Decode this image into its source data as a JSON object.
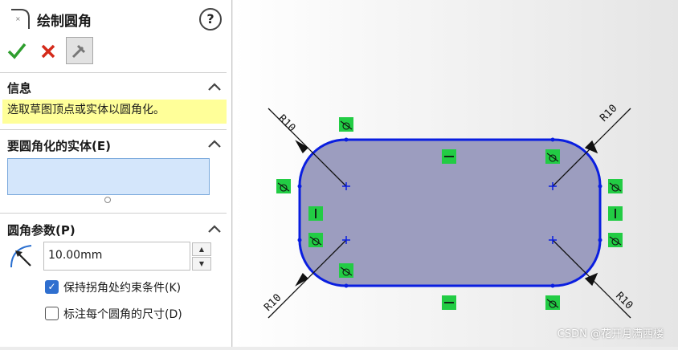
{
  "panel": {
    "title": "绘制圆角",
    "help_label": "?",
    "info": {
      "header": "信息",
      "message": "选取草图顶点或实体以圆角化。"
    },
    "entities": {
      "header": "要圆角化的实体(E)"
    },
    "params": {
      "header": "圆角参数(P)",
      "radius_value": "10.00mm",
      "keep_constraints_label": "保持拐角处约束条件(K)",
      "keep_constraints_checked": true,
      "dimension_each_label": "标注每个圆角的尺寸(D)",
      "dimension_each_checked": false
    }
  },
  "sketch": {
    "fillet_labels": [
      "R10",
      "R10",
      "R10",
      "R10"
    ],
    "outline_color": "#0a1ee0",
    "fill_color": "#9c9dbf",
    "relation_color": "#22cc44"
  },
  "watermark": "CSDN @花开月满西楼"
}
